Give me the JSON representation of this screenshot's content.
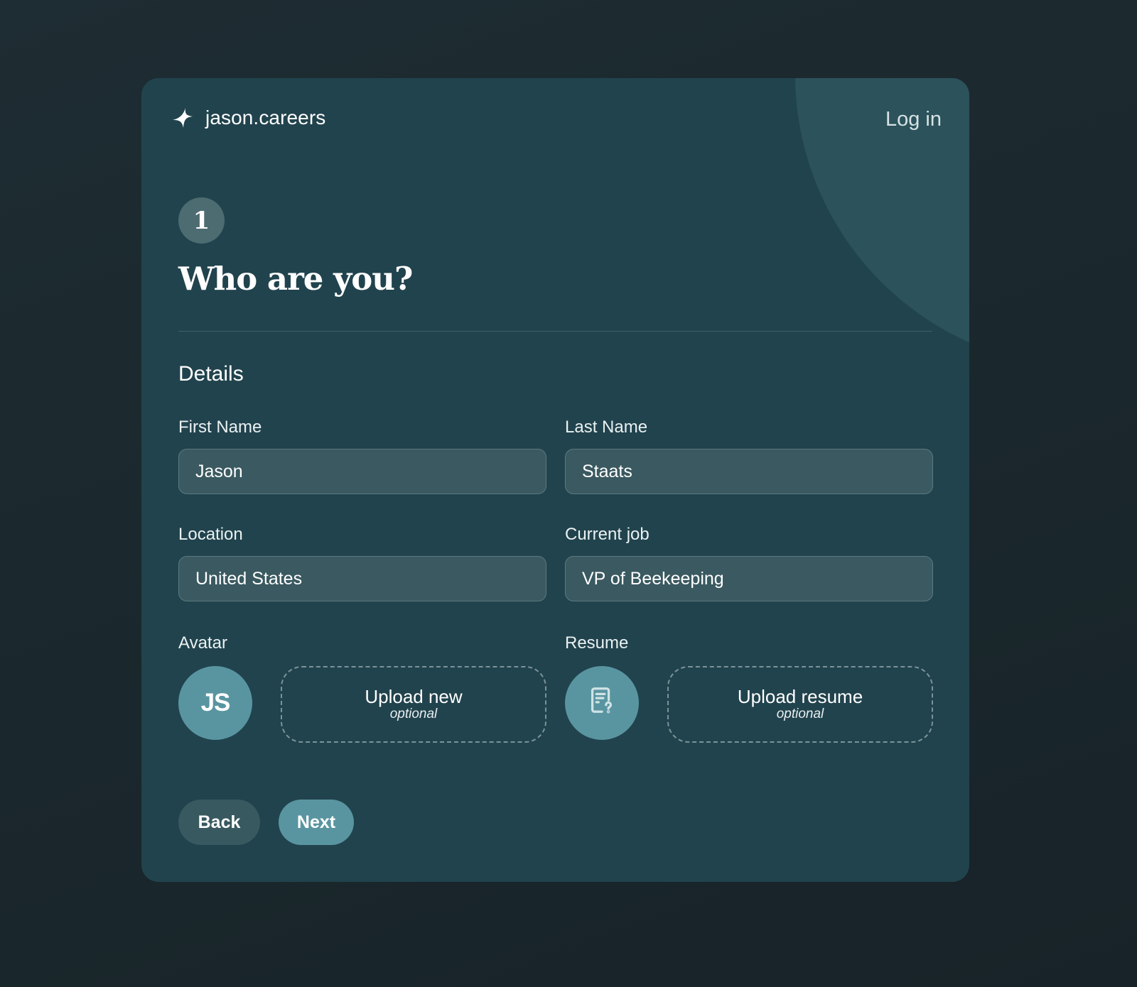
{
  "header": {
    "brand_name": "jason.careers",
    "brand_icon": "sparkle-icon",
    "login_label": "Log in"
  },
  "step": {
    "number": "1",
    "title": "Who are you?"
  },
  "section": {
    "title": "Details"
  },
  "fields": {
    "first_name": {
      "label": "First Name",
      "value": "Jason"
    },
    "last_name": {
      "label": "Last Name",
      "value": "Staats"
    },
    "location": {
      "label": "Location",
      "value": "United States"
    },
    "current_job": {
      "label": "Current job",
      "value": "VP of Beekeeping"
    }
  },
  "avatar": {
    "label": "Avatar",
    "initials": "JS",
    "upload_title": "Upload new",
    "upload_sub": "optional"
  },
  "resume": {
    "label": "Resume",
    "icon": "document-question-icon",
    "upload_title": "Upload resume",
    "upload_sub": "optional"
  },
  "actions": {
    "back_label": "Back",
    "next_label": "Next"
  },
  "colors": {
    "page_background": "#1b282d",
    "card_background": "#21434d",
    "accent": "#5995a1",
    "input_background": "#3a5960",
    "decor_circle": "#2c525b"
  }
}
